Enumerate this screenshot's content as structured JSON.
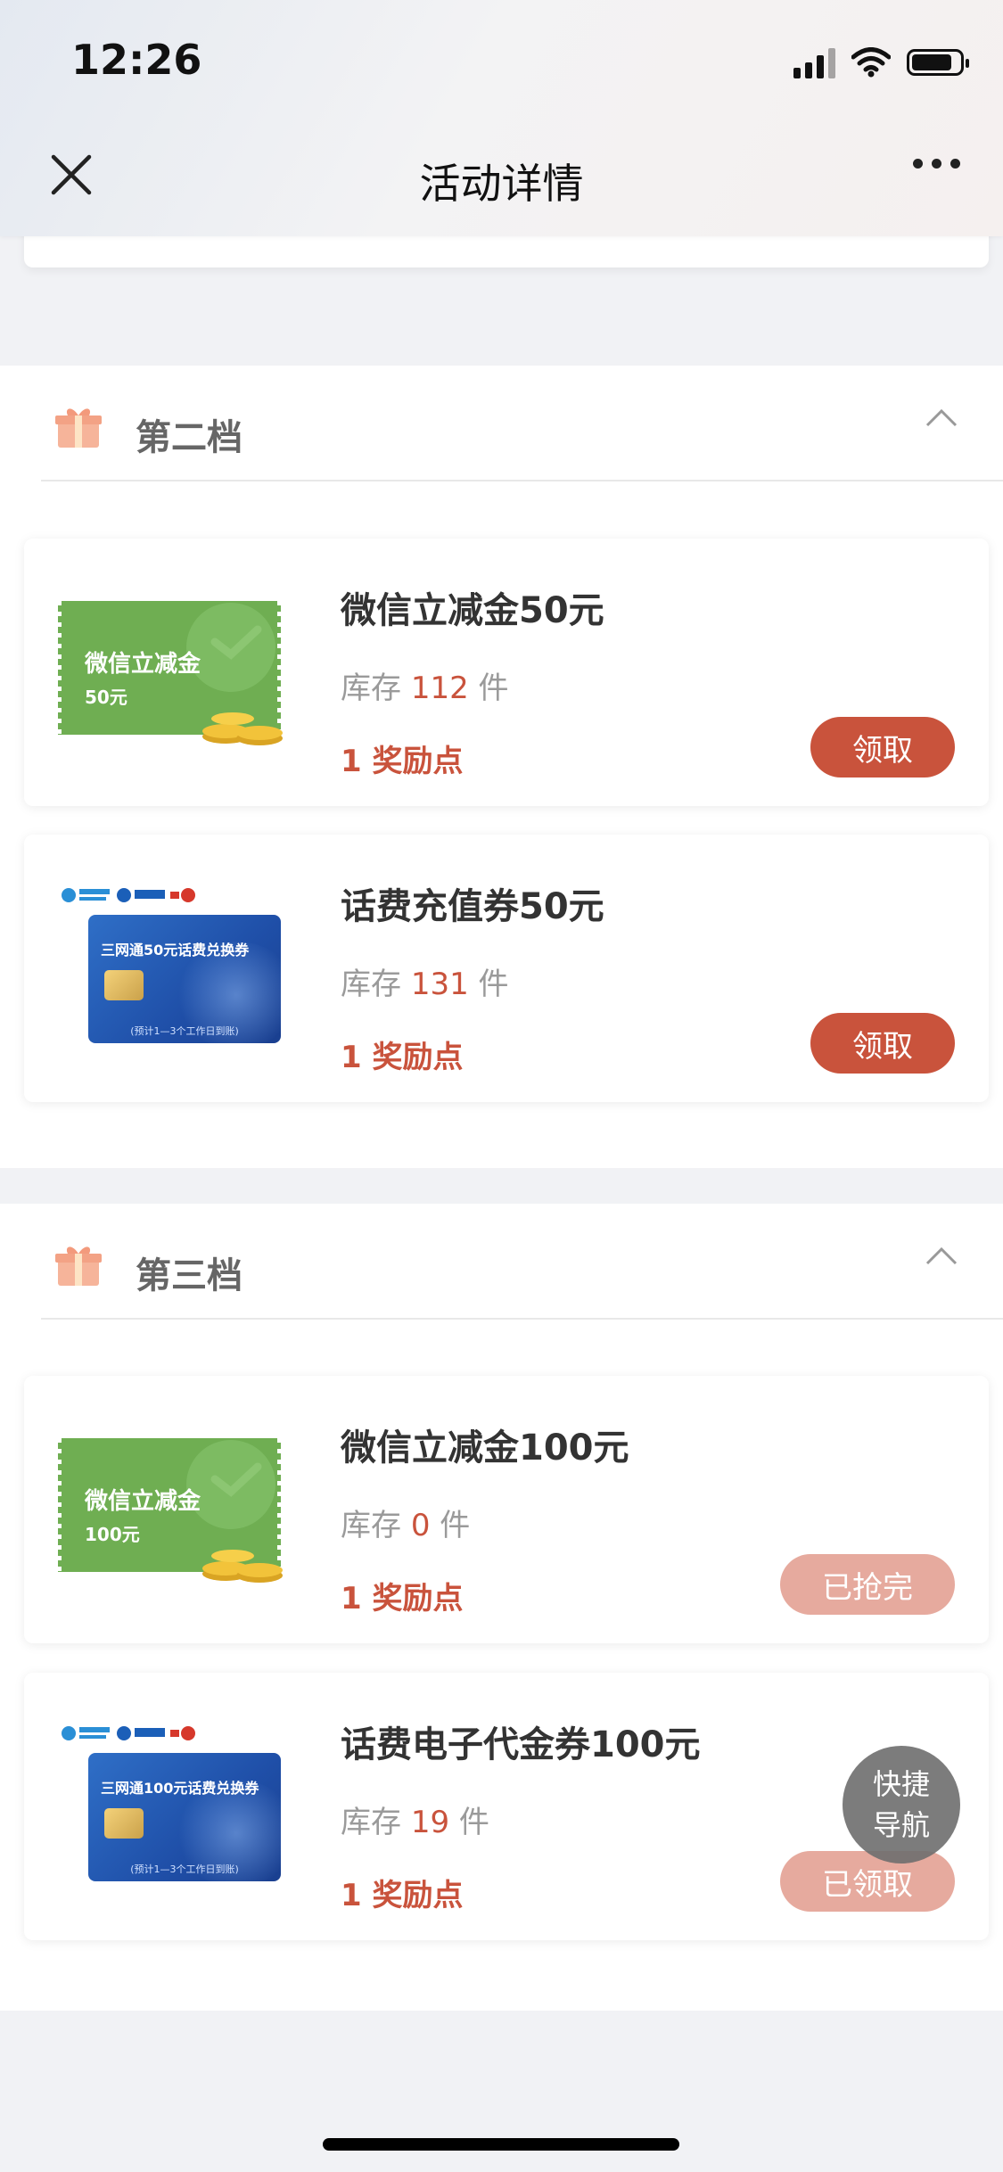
{
  "status_bar": {
    "time": "12:26"
  },
  "header": {
    "title": "活动详情"
  },
  "tiers": [
    {
      "name": "第二档",
      "items": [
        {
          "name": "微信立减金50元",
          "stock_prefix": "库存",
          "stock": "112",
          "stock_unit": "件",
          "points": "1 奖励点",
          "button": "领取",
          "thumb_title": "微信立减金",
          "thumb_amount": "50元"
        },
        {
          "name": "话费充值券50元",
          "stock_prefix": "库存",
          "stock": "131",
          "stock_unit": "件",
          "points": "1 奖励点",
          "button": "领取",
          "thumb_title": "三网通50元话费兑换券",
          "thumb_note": "(预计1—3个工作日到账)"
        }
      ]
    },
    {
      "name": "第三档",
      "items": [
        {
          "name": "微信立减金100元",
          "stock_prefix": "库存",
          "stock": "0",
          "stock_unit": "件",
          "points": "1 奖励点",
          "button": "已抢完",
          "thumb_title": "微信立减金",
          "thumb_amount": "100元"
        },
        {
          "name": "话费电子代金券100元",
          "stock_prefix": "库存",
          "stock": "19",
          "stock_unit": "件",
          "points": "1 奖励点",
          "button": "已领取",
          "thumb_title": "三网通100元话费兑换券",
          "thumb_note": "(预计1—3个工作日到账)"
        }
      ]
    }
  ],
  "quick_nav": {
    "line1": "快捷",
    "line2": "导航"
  },
  "colors": {
    "accent": "#c9533c",
    "disabled": "#e6aa9e",
    "voucher_green": "#6fae52",
    "card_blue": "#2f6fc7"
  }
}
